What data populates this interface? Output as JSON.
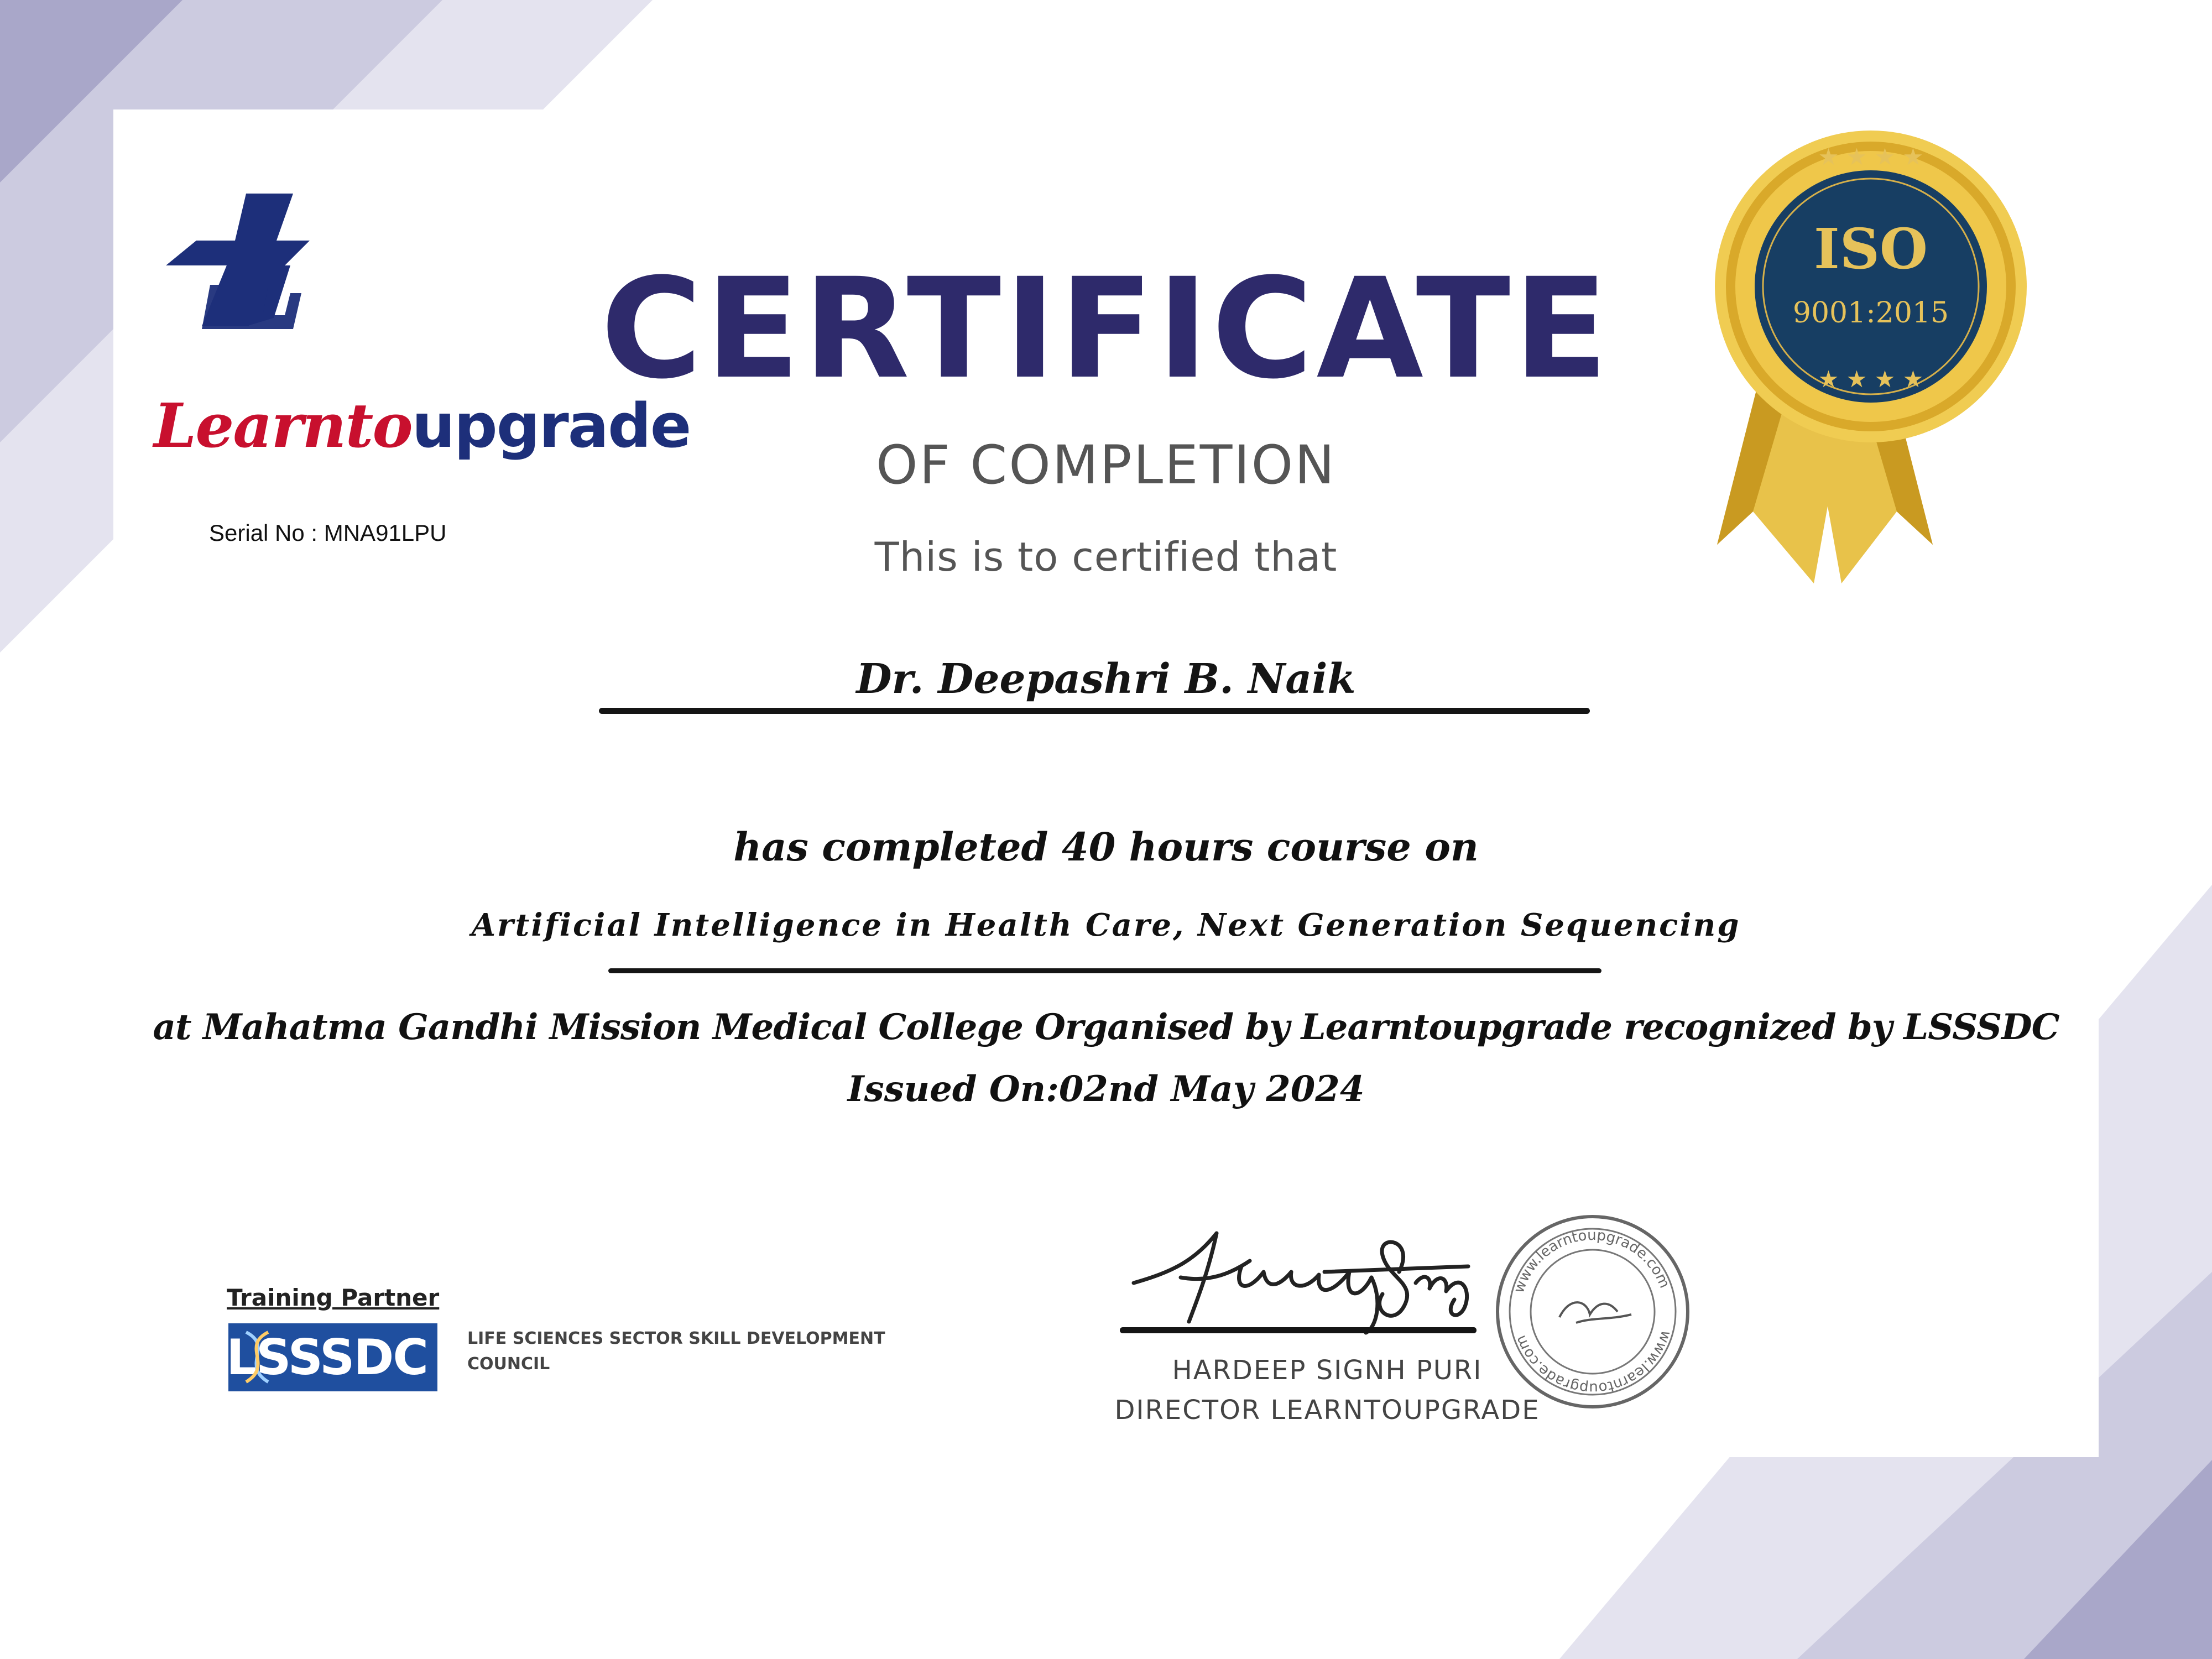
{
  "logo": {
    "wordmark_part1": "Learnto",
    "wordmark_part2": "upgrade"
  },
  "serial": "Serial No : MNA91LPU",
  "heading": {
    "title": "CERTIFICATE",
    "subtitle": "OF COMPLETION",
    "intro": "This is to certified that"
  },
  "recipient": "Dr. Deepashri B. Naik",
  "body": {
    "completed_line": "has completed 40 hours course on",
    "course": "Artificial Intelligence in Health Care, Next Generation Sequencing",
    "venue_line": "at Mahatma Gandhi Mission Medical College Organised by Learntoupgrade recognized by LSSSDC",
    "issued_line": "Issued On:02nd May 2024"
  },
  "iso_seal": {
    "label": "ISO",
    "standard": "9001:2015"
  },
  "partner": {
    "heading": "Training Partner",
    "badge": "LSSSDC",
    "council_name": "LIFE SCIENCES SECTOR SKILL DEVELOPMENT COUNCIL"
  },
  "signatory": {
    "name": "HARDEEP SIGNH PURI",
    "title": "DIRECTOR LEARNTOUPGRADE",
    "stamp_text": "www.learntoupgrade.com"
  },
  "colors": {
    "title": "#2e2a6b",
    "logo_blue": "#1d2f7a",
    "logo_red": "#c8102e",
    "gold": "#e3b633",
    "seal_navy": "#173e63",
    "frame_lavender": "#a9a7c9"
  }
}
